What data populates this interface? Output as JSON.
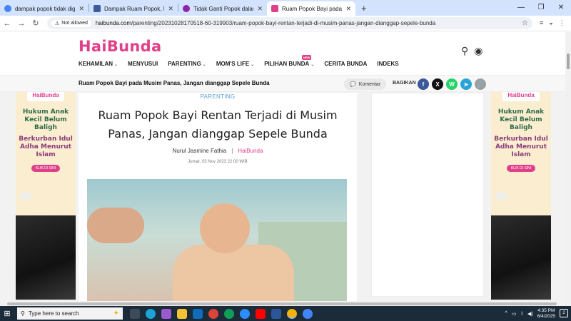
{
  "browser": {
    "tabs": [
      {
        "label": "dampak popok tidak diganti - G",
        "favicon_color": "#4285f4",
        "active": false
      },
      {
        "label": "Dampak Ruam Popok, Bisa Hal",
        "favicon_color": "#3d5a99",
        "active": false
      },
      {
        "label": "Tidak Ganti Popok dalam Wakt",
        "favicon_color": "#8e24aa",
        "active": false
      },
      {
        "label": "Ruam Popok Bayi pada Musim",
        "favicon_color": "#e0408a",
        "active": true
      }
    ],
    "new_tab_icon": "plus-icon",
    "security_chip": "Not allowed",
    "url_host": "haibunda.com",
    "url_path": "/parenting/20231028170518-60-319903/ruam-popok-bayi-rentan-terjadi-di-musim-panas-jangan-dianggap-sepele-bunda"
  },
  "site": {
    "logo": "HaiBunda",
    "nav": [
      {
        "label": "KEHAMILAN",
        "caret": true
      },
      {
        "label": "MENYUSUI",
        "caret": false
      },
      {
        "label": "PARENTING",
        "caret": true
      },
      {
        "label": "MOM'S LIFE",
        "caret": true
      },
      {
        "label": "PILIHAN BUNDA",
        "caret": true,
        "badge": "NEW"
      },
      {
        "label": "CERITA BUNDA",
        "caret": false
      },
      {
        "label": "INDEKS",
        "caret": false
      }
    ]
  },
  "sticky": {
    "title": "Ruam Popok Bayi pada Musim Panas, Jangan dianggap Sepele Bunda",
    "comment_label": "Komentar",
    "share_label": "BAGIKAN",
    "share_buttons": [
      {
        "name": "facebook",
        "glyph": "f",
        "color": "#3b5998"
      },
      {
        "name": "x",
        "glyph": "X",
        "color": "#111111"
      },
      {
        "name": "whatsapp",
        "glyph": "W",
        "color": "#25d366"
      },
      {
        "name": "telegram",
        "glyph": "➤",
        "color": "#2aa3d9"
      },
      {
        "name": "copy-link",
        "glyph": "🔗",
        "color": "#9e9e9e"
      }
    ]
  },
  "ad": {
    "logo": "HaiBunda",
    "headline": "Hukum Anak Kecil Belum Baligh",
    "subheadline": "Berkurban Idul Adha Menurut Islam",
    "cta": "KLIK DI SINI"
  },
  "article": {
    "category": "PARENTING",
    "title": "Ruam Popok Bayi Rentan Terjadi di Musim Panas, Jangan dianggap Sepele Bunda",
    "author": "Nurul Jasmine Fathia",
    "source": "HaiBunda",
    "date": "Jumat, 03 Nov 2023 22:00 WIB"
  },
  "taskbar": {
    "search_placeholder": "Type here to search",
    "time": "4:35 PM",
    "date": "6/4/2025",
    "notification_count": "2"
  },
  "colors": {
    "brand": "#e0408a",
    "category": "#5a9fd4",
    "tabstrip": "#d3e3fd",
    "taskbar": "#1c2b3a"
  }
}
